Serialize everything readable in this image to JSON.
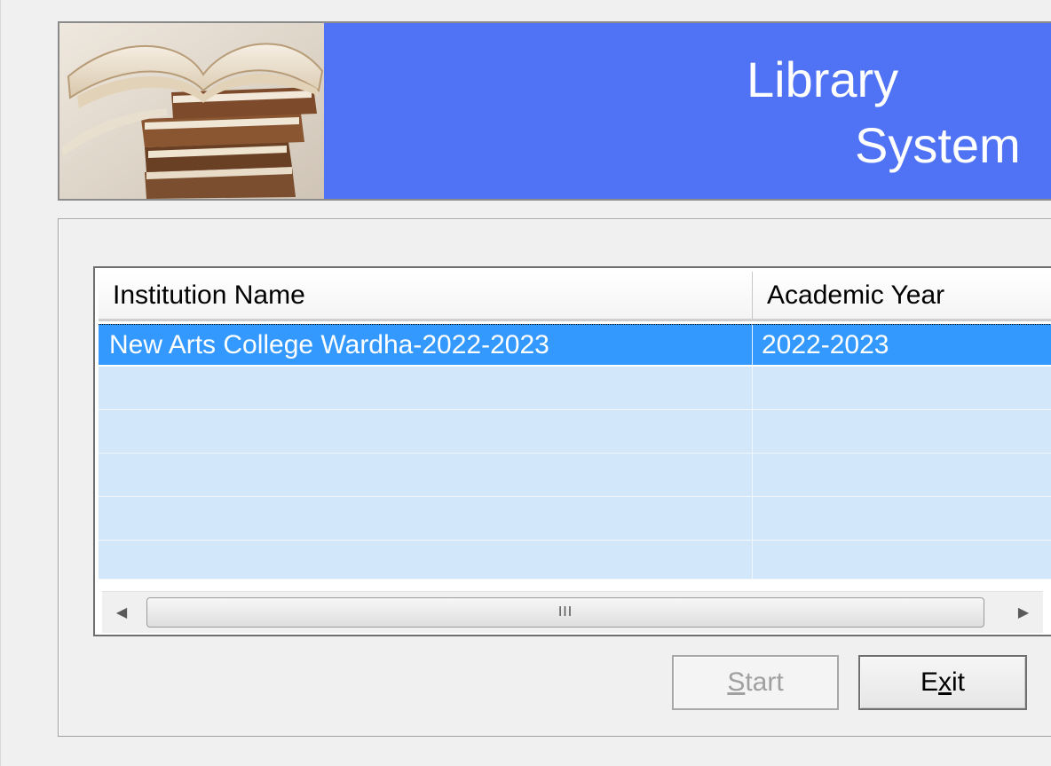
{
  "header": {
    "title_line1": "Library",
    "title_line2": "System",
    "banner_color": "#4f73f4",
    "image_icon": "stacked-books-image"
  },
  "institution_list": {
    "columns": [
      "Institution Name",
      "Academic Year"
    ],
    "rows": [
      {
        "institution": "New Arts College Wardha-2022-2023",
        "year": "2022-2023",
        "selected": true
      },
      {
        "institution": "",
        "year": "",
        "selected": false
      },
      {
        "institution": "",
        "year": "",
        "selected": false
      },
      {
        "institution": "",
        "year": "",
        "selected": false
      },
      {
        "institution": "",
        "year": "",
        "selected": false
      },
      {
        "institution": "",
        "year": "",
        "selected": false
      }
    ],
    "selection_color": "#3399ff",
    "row_color": "#d3e7fb",
    "scrollbar": {
      "left_icon": "arrow-left-icon",
      "right_icon": "arrow-right-icon",
      "thumb_grip": "III"
    }
  },
  "buttons": {
    "start": {
      "label_underlined": "S",
      "label_rest": "tart",
      "enabled": false
    },
    "exit": {
      "label_pre": "E",
      "label_underlined": "x",
      "label_rest": "it",
      "enabled": true
    }
  }
}
